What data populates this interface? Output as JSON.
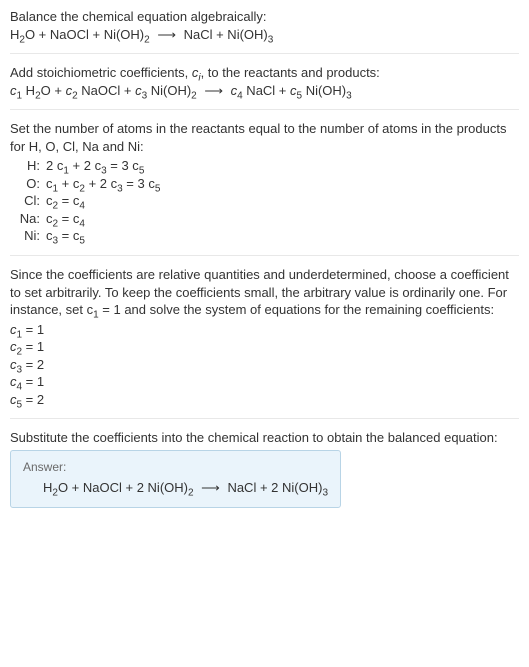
{
  "s1": {
    "title": "Balance the chemical equation algebraically:",
    "eq_lhs1": "H",
    "eq_lhs1b": "2",
    "eq_lhs1c": "O + NaOCl + Ni(OH)",
    "eq_lhs1d": "2",
    "arrow": "⟶",
    "eq_rhs": "NaCl + Ni(OH)",
    "eq_rhs_b": "3"
  },
  "s2": {
    "intro_a": "Add stoichiometric coefficients, ",
    "c": "c",
    "i": "i",
    "intro_b": ", to the reactants and products:",
    "c1": "c",
    "c1s": "1",
    "sp1": " H",
    "sp1b": "2",
    "sp1c": "O + ",
    "c2": "c",
    "c2s": "2",
    "sp2": " NaOCl + ",
    "c3": "c",
    "c3s": "3",
    "sp3": " Ni(OH)",
    "sp3b": "2",
    "arrow": "⟶",
    "c4": "c",
    "c4s": "4",
    "sp4": " NaCl + ",
    "c5": "c",
    "c5s": "5",
    "sp5": " Ni(OH)",
    "sp5b": "3"
  },
  "s3": {
    "intro": "Set the number of atoms in the reactants equal to the number of atoms in the products for H, O, Cl, Na and Ni:",
    "rows": [
      {
        "el": "H:",
        "eq_a": "2 c",
        "s1": "1",
        "mid": " + 2 c",
        "s2": "3",
        "eqs": " = 3 c",
        "s3": "5"
      },
      {
        "el": "O:",
        "eq_a": "c",
        "s1": "1",
        "mid": " + c",
        "s2": "2",
        "mid2": " + 2 c",
        "s3": "3",
        "eqs": " = 3 c",
        "s4": "5"
      },
      {
        "el": "Cl:",
        "eq_a": "c",
        "s1": "2",
        "eqs": " = c",
        "s2": "4"
      },
      {
        "el": "Na:",
        "eq_a": "c",
        "s1": "2",
        "eqs": " = c",
        "s2": "4"
      },
      {
        "el": "Ni:",
        "eq_a": "c",
        "s1": "3",
        "eqs": " = c",
        "s2": "5"
      }
    ]
  },
  "s4": {
    "intro_a": "Since the coefficients are relative quantities and underdetermined, choose a coefficient to set arbitrarily. To keep the coefficients small, the arbitrary value is ordinarily one. For instance, set c",
    "sub1": "1",
    "intro_b": " = 1 and solve the system of equations for the remaining coefficients:",
    "lines": [
      {
        "c": "c",
        "s": "1",
        "v": " = 1"
      },
      {
        "c": "c",
        "s": "2",
        "v": " = 1"
      },
      {
        "c": "c",
        "s": "3",
        "v": " = 2"
      },
      {
        "c": "c",
        "s": "4",
        "v": " = 1"
      },
      {
        "c": "c",
        "s": "5",
        "v": " = 2"
      }
    ]
  },
  "s5": {
    "intro": "Substitute the coefficients into the chemical reaction to obtain the balanced equation:",
    "answer_label": "Answer:",
    "eq_a": "H",
    "eq_a2": "2",
    "eq_b": "O + NaOCl + 2 Ni(OH)",
    "eq_b2": "2",
    "arrow": "⟶",
    "eq_c": "NaCl + 2 Ni(OH)",
    "eq_c2": "3"
  }
}
